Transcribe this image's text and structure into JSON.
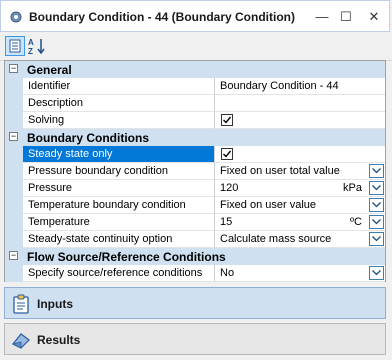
{
  "window": {
    "title": "Boundary Condition - 44 (Boundary Condition)",
    "minimize_glyph": "—",
    "maximize_glyph": "☐",
    "close_glyph": "✕"
  },
  "toolbar": {
    "categorized_icon": "categorized-view-icon",
    "alphabetical_icon": "alphabetical-sort-icon"
  },
  "grid": {
    "general": {
      "label": "General",
      "toggle": "−",
      "rows": [
        {
          "name": "Identifier",
          "value": "Boundary Condition - 44"
        },
        {
          "name": "Description",
          "value": ""
        },
        {
          "name": "Solving",
          "checked": true
        }
      ]
    },
    "boundary": {
      "label": "Boundary Conditions",
      "toggle": "−",
      "rows": [
        {
          "name": "Steady state only",
          "checked": true,
          "selected": true
        },
        {
          "name": "Pressure boundary condition",
          "value": "Fixed on user total value"
        },
        {
          "name": "Pressure",
          "value": "120",
          "unit": "kPa"
        },
        {
          "name": "Temperature boundary condition",
          "value": "Fixed on user value"
        },
        {
          "name": "Temperature",
          "value": "15",
          "unit": "ºC"
        },
        {
          "name": "Steady-state continuity option",
          "value": "Calculate mass source"
        }
      ]
    },
    "flow": {
      "label": "Flow Source/Reference Conditions",
      "toggle": "−",
      "rows": [
        {
          "name": "Specify source/reference conditions",
          "value": "No"
        }
      ]
    }
  },
  "panels": {
    "inputs": {
      "label": "Inputs",
      "icon": "clipboard-icon",
      "selected": true
    },
    "results": {
      "label": "Results",
      "icon": "results-icon",
      "selected": false
    }
  },
  "colors": {
    "category_bg": "#cfe0f1",
    "selection": "#0078d7",
    "inputs_bar": "#cfe0f1",
    "results_bar": "#e6e6e6"
  }
}
